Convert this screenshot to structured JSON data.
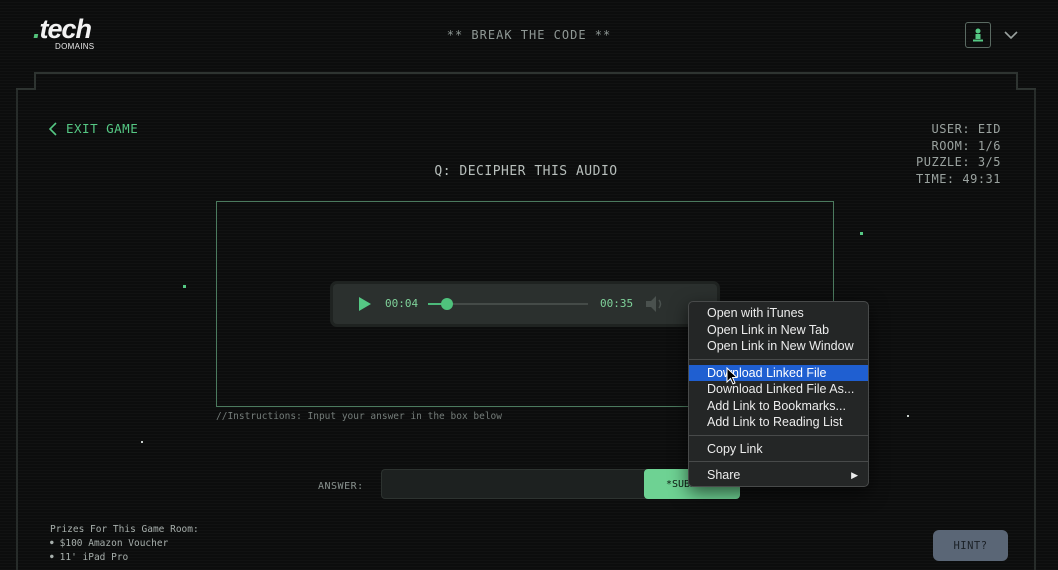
{
  "header": {
    "logo_main": ".tech",
    "logo_sub": "DOMAINS",
    "title": "** BREAK THE CODE **",
    "user_icon": "user-icon",
    "chevron_icon": "chevron-down-icon"
  },
  "nav": {
    "exit_label": "EXIT GAME"
  },
  "status": {
    "user": "USER: EID",
    "room": "ROOM: 1/6",
    "puzzle": "PUZZLE: 3/5",
    "time": "TIME: 49:31"
  },
  "question": "Q: DECIPHER THIS AUDIO",
  "player": {
    "current_time": "00:04",
    "total_time": "00:35",
    "progress": 0.12
  },
  "instructions": "//Instructions: Input your answer in the box below",
  "answer": {
    "label": "ANSWER:",
    "value": "",
    "submit_label": "*SUBMIT*"
  },
  "prizes": {
    "title": "Prizes For This Game Room:",
    "items": [
      "$100 Amazon Voucher",
      "11' iPad Pro"
    ]
  },
  "hint_label": "HINT?",
  "context_menu": {
    "groups": [
      [
        "Open with iTunes",
        "Open Link in New Tab",
        "Open Link in New Window"
      ],
      [
        "Download Linked File",
        "Download Linked File As...",
        "Add Link to Bookmarks...",
        "Add Link to Reading List"
      ],
      [
        "Copy Link"
      ],
      [
        "Share"
      ]
    ],
    "selected": "Download Linked File"
  },
  "colors": {
    "accent_green": "#55c884",
    "background": "#0c0d0d",
    "menu_highlight": "#1f5fd1"
  }
}
